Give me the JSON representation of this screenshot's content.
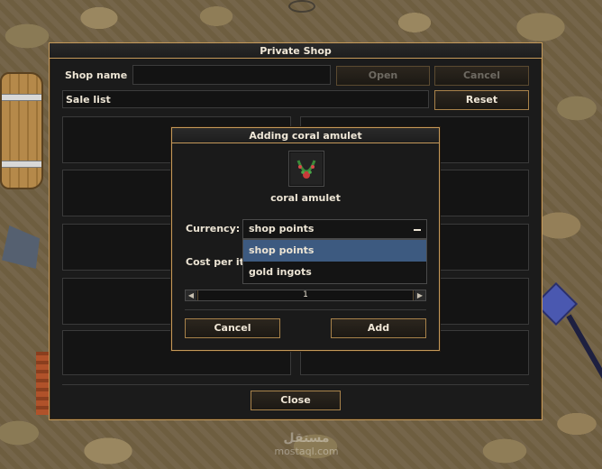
{
  "shop_window": {
    "title": "Private Shop",
    "shop_name_label": "Shop name",
    "shop_name_value": "",
    "sale_list_label": "Sale list",
    "open_button": "Open",
    "cancel_button": "Cancel",
    "reset_button": "Reset",
    "close_button": "Close"
  },
  "modal": {
    "title": "Adding coral amulet",
    "item_icon": "coral-amulet-icon",
    "item_name": "coral amulet",
    "currency_label": "Currency:",
    "currency_selected": "shop points",
    "currency_options": [
      "shop points",
      "gold ingots"
    ],
    "cost_label": "Cost per ite",
    "cost_value": "1",
    "cancel_button": "Cancel",
    "add_button": "Add"
  },
  "colors": {
    "accent_border": "#c69a5a",
    "selected_option": "#3d5a80",
    "panel_bg": "#1b1b1b"
  },
  "watermark": {
    "logo": "مستقل",
    "text": "mostaql.com"
  }
}
